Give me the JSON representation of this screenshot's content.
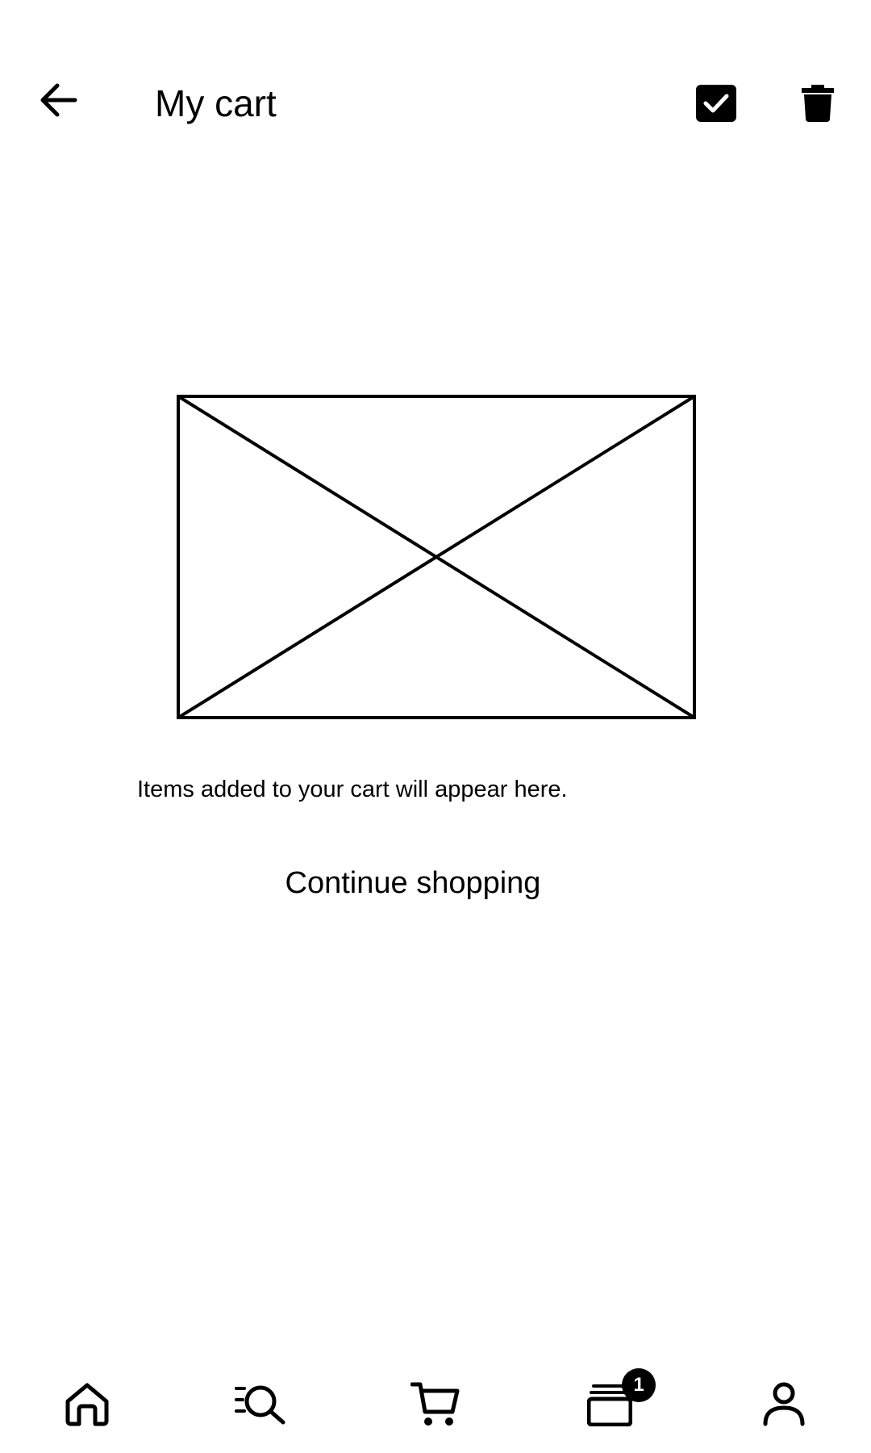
{
  "header": {
    "title": "My cart",
    "back_icon": "arrow-left-icon",
    "select_all_icon": "checkbox-checked-icon",
    "delete_icon": "trash-icon"
  },
  "empty_state": {
    "image": "image-placeholder",
    "message": "Items added to your cart will appear here.",
    "continue_label": "Continue shopping"
  },
  "bottom_nav": {
    "items": [
      {
        "name": "home",
        "icon": "home-icon"
      },
      {
        "name": "search",
        "icon": "search-list-icon"
      },
      {
        "name": "cart",
        "icon": "cart-icon"
      },
      {
        "name": "orders",
        "icon": "card-stack-icon",
        "badge": "1"
      },
      {
        "name": "account",
        "icon": "user-icon"
      }
    ]
  },
  "colors": {
    "foreground": "#000000",
    "background": "#ffffff"
  }
}
